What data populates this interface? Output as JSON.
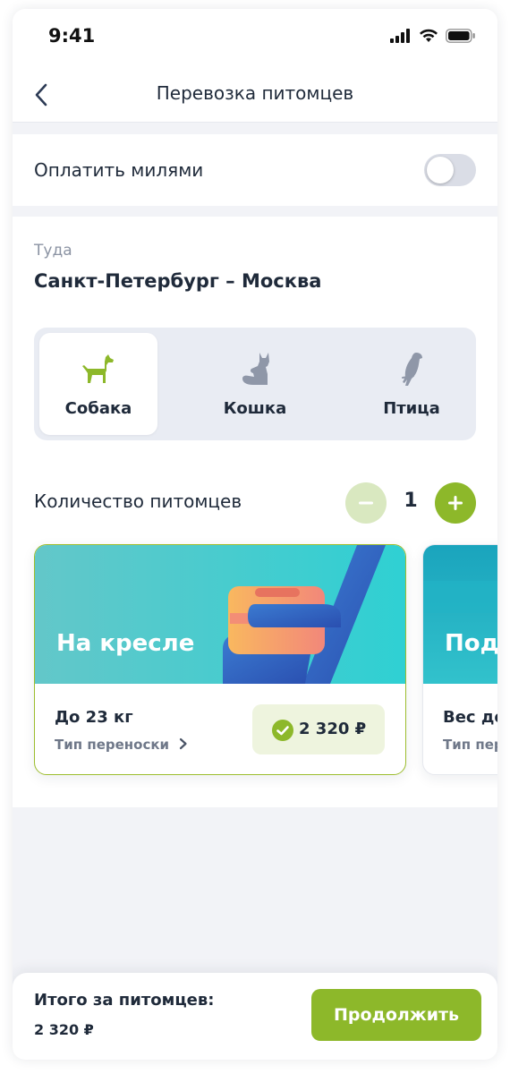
{
  "status_bar": {
    "time": "9:41"
  },
  "header": {
    "title": "Перевозка питомцев"
  },
  "miles": {
    "label": "Оплатить милями",
    "enabled": false
  },
  "trip": {
    "direction_label": "Туда",
    "route": "Санкт-Петербург – Москва"
  },
  "pet_types": [
    {
      "label": "Собака",
      "icon": "dog-icon",
      "selected": true
    },
    {
      "label": "Кошка",
      "icon": "cat-icon",
      "selected": false
    },
    {
      "label": "Птица",
      "icon": "bird-icon",
      "selected": false
    }
  ],
  "pet_count": {
    "label": "Количество питомцев",
    "value": "1"
  },
  "options": [
    {
      "title": "На кресле",
      "weight": "До 23 кг",
      "carrier_link": "Тип переноски",
      "price": "2 320 ₽",
      "selected": true
    },
    {
      "title": "Под",
      "weight": "Вес до",
      "carrier_link": "Тип пер",
      "price": "",
      "selected": false
    }
  ],
  "footer": {
    "total_label": "Итого за питомцев:",
    "total_value": "2 320 ₽",
    "continue_label": "Продолжить"
  },
  "colors": {
    "accent": "#8db82a",
    "accent_light": "#d9e8c0",
    "text": "#1f2a3a",
    "muted": "#8b93a3",
    "bg": "#f2f3f7"
  }
}
